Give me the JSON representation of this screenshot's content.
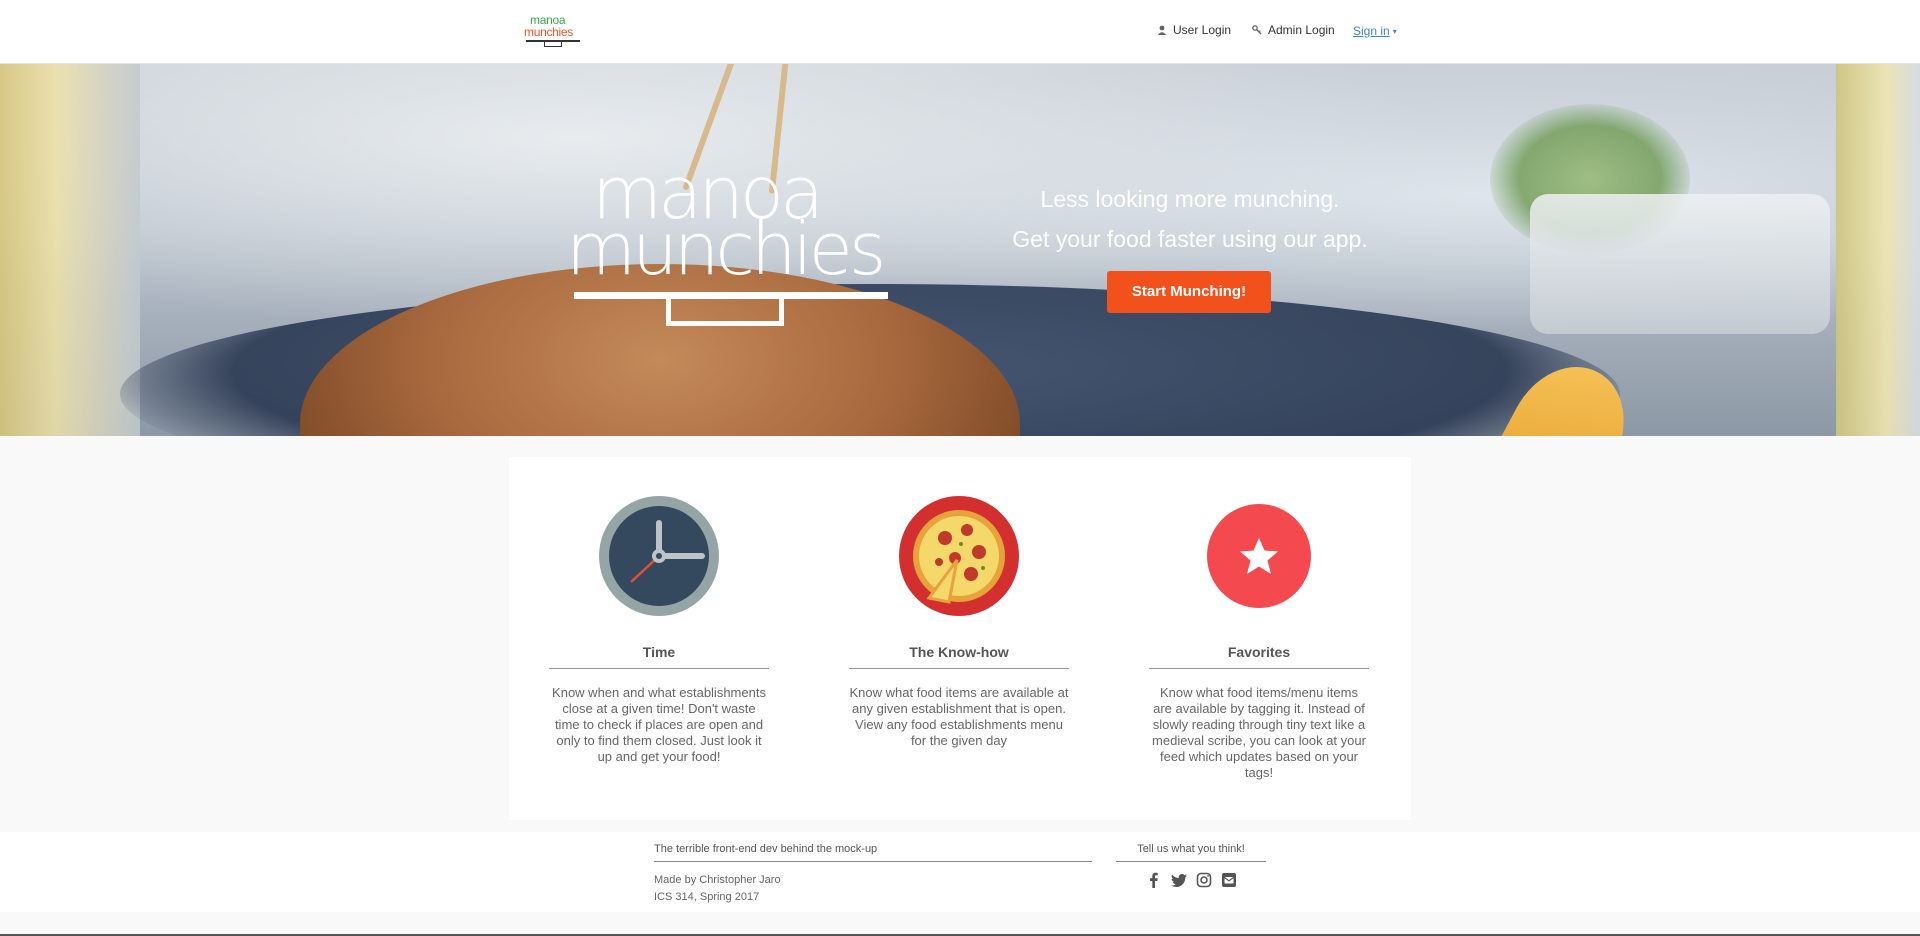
{
  "nav": {
    "logo_line1": "manoa",
    "logo_line2": "munchies",
    "user_login": "User Login",
    "admin_login": "Admin Login",
    "sign_in": "Sign in",
    "sign_in_caret": "▾"
  },
  "hero": {
    "logo_line1": "manoa",
    "logo_line2": "munchies",
    "tagline_1": "Less looking more munching.",
    "tagline_2": "Get your food faster using our app.",
    "cta_label": "Start Munching!"
  },
  "features": [
    {
      "icon": "clock-icon",
      "title": "Time",
      "description": "Know when and what establishments close at a given time! Don't waste time to check if places are open and only to find them closed. Just look it up and get your food!"
    },
    {
      "icon": "pizza-icon",
      "title": "The Know-how",
      "description": "Know what food items are available at any given establishment that is open. View any food establishments menu for the given day"
    },
    {
      "icon": "star-icon",
      "title": "Favorites",
      "description": "Know what food items/menu items are available by tagging it. Instead of slowly reading through tiny text like a medieval scribe, you can look at your feed which updates based on your tags!"
    }
  ],
  "footer": {
    "dev_heading": "The terrible front-end dev behind the mock-up",
    "made_by": "Made by Christopher Jaro",
    "course": "ICS 314, Spring 2017",
    "feedback_heading": "Tell us what you think!",
    "social_icons": [
      "facebook-icon",
      "twitter-icon",
      "instagram-icon",
      "email-icon"
    ]
  },
  "colors": {
    "accent": "#f2511b",
    "link": "#4183c4",
    "clock_face": "#34495e",
    "clock_ring": "#95a5a6",
    "pizza_red": "#e53935",
    "favorite_red": "#f44a4f"
  }
}
